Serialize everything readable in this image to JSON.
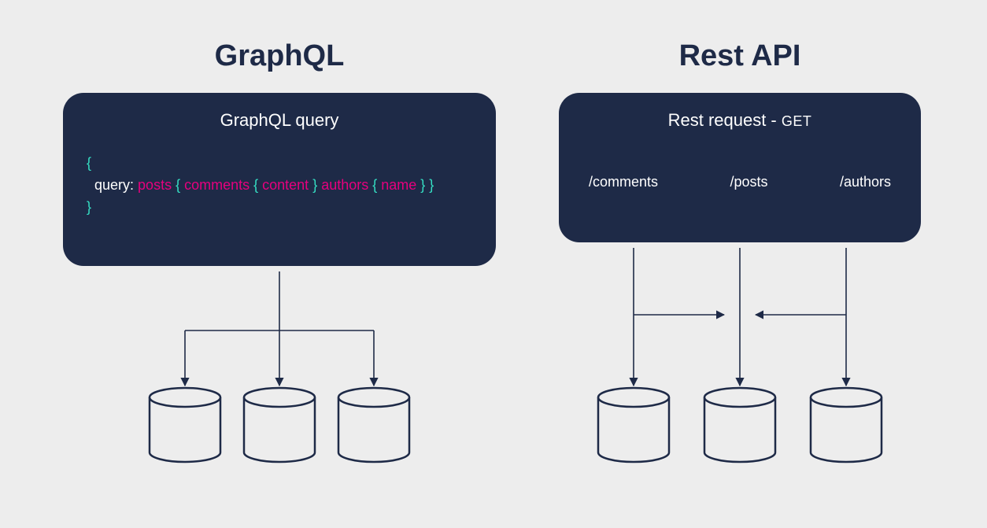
{
  "left": {
    "title": "GraphQL",
    "card_title": "GraphQL query",
    "query": {
      "open": "{",
      "line_indent": "query: ",
      "posts": "posts",
      "b1o": " { ",
      "comments": "comments",
      "b2o": " { ",
      "content": "content",
      "b2c": " } ",
      "authors": "authors",
      "b3o": " { ",
      "name": "name",
      "b3c": " } }",
      "close": "}"
    }
  },
  "right": {
    "title": "Rest API",
    "card_title_prefix": "Rest request - ",
    "card_title_method": "GET",
    "endpoints": [
      "/comments",
      "/posts",
      "/authors"
    ]
  },
  "colors": {
    "card_bg": "#1e2a47",
    "cyan": "#35e0c4",
    "pink": "#e6007e",
    "page_bg": "#ededed"
  }
}
